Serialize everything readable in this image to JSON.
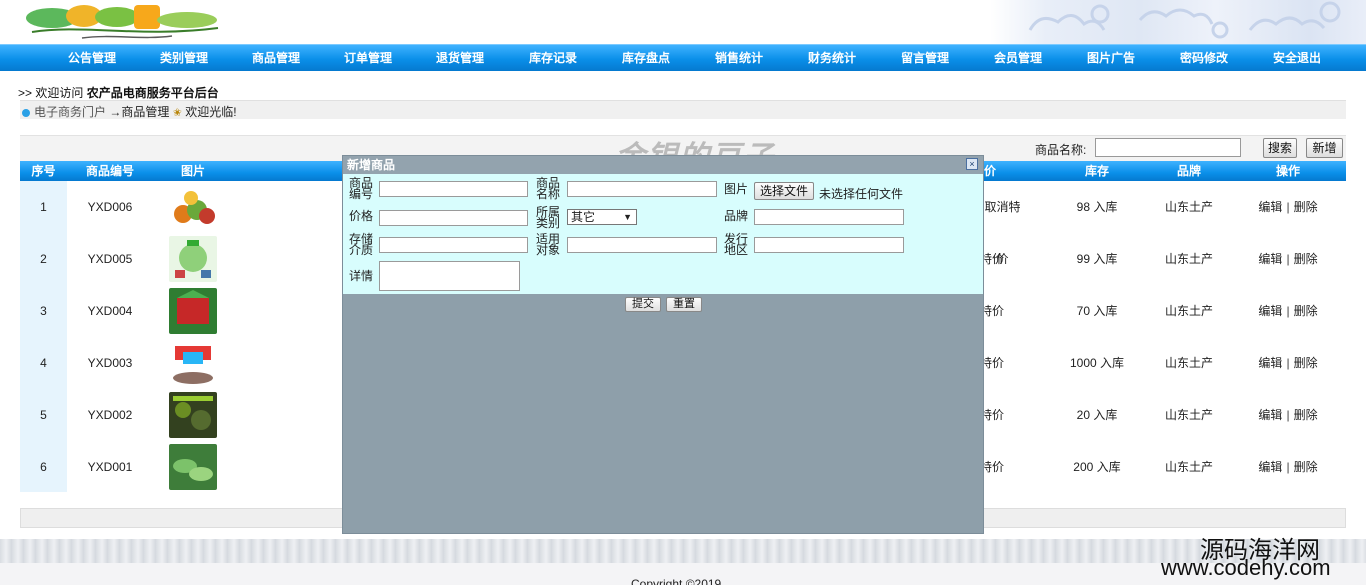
{
  "nav": {
    "items": [
      "公告管理",
      "类别管理",
      "商品管理",
      "订单管理",
      "退货管理",
      "库存记录",
      "库存盘点",
      "销售统计",
      "财务统计",
      "留言管理",
      "会员管理",
      "图片广告",
      "密码修改",
      "安全退出"
    ]
  },
  "welcome": {
    "prefix": ">> 欢迎访问",
    "site": "农产品电商服务平台后台"
  },
  "breadcrumb": {
    "portal": "电子商务门户",
    "arrow": "→",
    "current": "商品管理",
    "greet": "欢迎光临!"
  },
  "search": {
    "label": "商品名称:",
    "value": "",
    "search_btn": "搜索",
    "add_btn": "新增"
  },
  "table": {
    "headers": [
      "序号",
      "商品编号",
      "图片",
      "价",
      "库存",
      "品牌",
      "操作"
    ],
    "rows": [
      {
        "idx": "1",
        "code": "YXD006",
        "price": "取消特价",
        "stock": "98",
        "stock_link": "入库",
        "brand": "山东土产",
        "edit": "编辑",
        "sep": "|",
        "del": "删除"
      },
      {
        "idx": "2",
        "code": "YXD005",
        "price": "特价",
        "stock": "99",
        "stock_link": "入库",
        "brand": "山东土产",
        "edit": "编辑",
        "sep": "|",
        "del": "删除"
      },
      {
        "idx": "3",
        "code": "YXD004",
        "price": "特价",
        "stock": "70",
        "stock_link": "入库",
        "brand": "山东土产",
        "edit": "编辑",
        "sep": "|",
        "del": "删除"
      },
      {
        "idx": "4",
        "code": "YXD003",
        "price": "特价",
        "stock": "1000",
        "stock_link": "入库",
        "brand": "山东土产",
        "edit": "编辑",
        "sep": "|",
        "del": "删除"
      },
      {
        "idx": "5",
        "code": "YXD002",
        "price": "特价",
        "stock": "20",
        "stock_link": "入库",
        "brand": "山东土产",
        "edit": "编辑",
        "sep": "|",
        "del": "删除"
      },
      {
        "idx": "6",
        "code": "YXD001",
        "price": "特价",
        "stock": "200",
        "stock_link": "入库",
        "brand": "山东土产",
        "edit": "编辑",
        "sep": "|",
        "del": "删除"
      }
    ]
  },
  "modal": {
    "title": "新增商品",
    "close": "×",
    "labels": {
      "code": "商品编号",
      "name": "商品名称",
      "image": "图片",
      "price": "价格",
      "category": "所属类别",
      "brand": "品牌",
      "storage": "存储介质",
      "target": "适用对象",
      "region": "发行地区",
      "detail": "详情"
    },
    "file_btn": "选择文件",
    "file_status": "未选择任何文件",
    "category_selected": "其它",
    "submit": "提交",
    "reset": "重置"
  },
  "footer": {
    "copyright": "Copyright ©2019"
  },
  "watermark": {
    "top": "金银的豆子",
    "br_line1": "源码海洋网",
    "br_line2": "www.codehy.com"
  },
  "colors": {
    "nav_blue": "#0a8fe9",
    "modal_gray": "#8e9faa",
    "form_bg": "#d8fdfd"
  }
}
